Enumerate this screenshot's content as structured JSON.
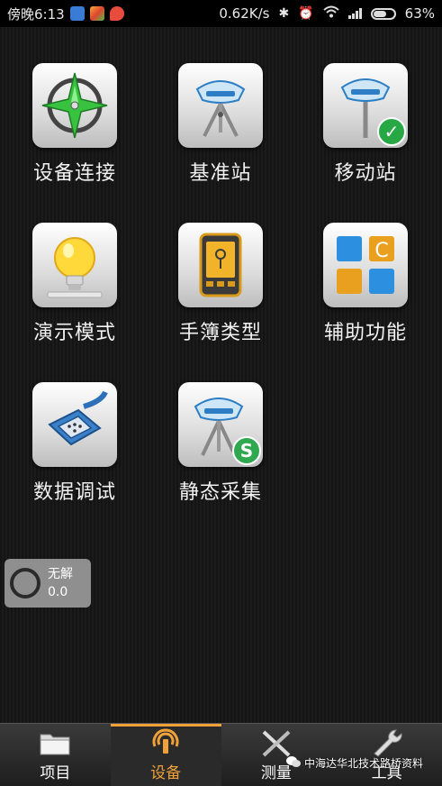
{
  "status_bar": {
    "time": "傍晚6:13",
    "net_speed": "0.62K/s",
    "battery": "63%"
  },
  "tiles": [
    {
      "label": "设备连接",
      "icon": "compass-icon"
    },
    {
      "label": "基准站",
      "icon": "base-station-receiver-icon"
    },
    {
      "label": "移动站",
      "icon": "rover-receiver-icon"
    },
    {
      "label": "演示模式",
      "icon": "lightbulb-icon"
    },
    {
      "label": "手簿类型",
      "icon": "handheld-controller-icon"
    },
    {
      "label": "辅助功能",
      "icon": "grid-tools-icon"
    },
    {
      "label": "数据调试",
      "icon": "serial-connector-icon"
    },
    {
      "label": "静态采集",
      "icon": "static-survey-receiver-icon"
    }
  ],
  "fix_status": {
    "label": "无解",
    "value": "0.0"
  },
  "bottom_nav": [
    {
      "label": "项目",
      "icon": "folder-icon",
      "active": false
    },
    {
      "label": "设备",
      "icon": "signal-device-icon",
      "active": true
    },
    {
      "label": "测量",
      "icon": "measure-tools-icon",
      "active": false
    },
    {
      "label": "工具",
      "icon": "wrench-icon",
      "active": false
    }
  ],
  "watermark": "中海达华北技术路桥资料",
  "colors": {
    "accent": "#f0a23a",
    "background": "#141414",
    "badge_green": "#28a745"
  }
}
